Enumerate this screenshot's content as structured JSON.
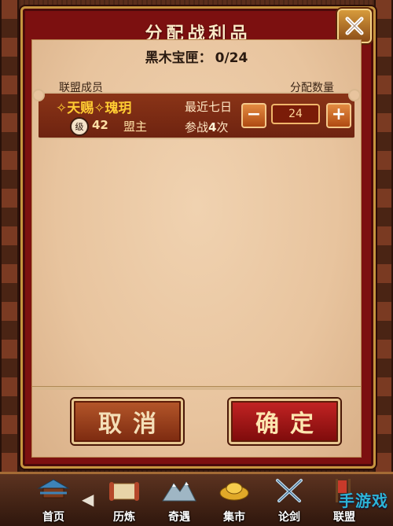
{
  "dialog": {
    "title": "分配战利品",
    "chest_label": "黑木宝匣：",
    "chest_count": "0/24"
  },
  "columns": {
    "member": "联盟成员",
    "quantity": "分配数量"
  },
  "member": {
    "name": "✧天赐✧瑰玥",
    "level_badge": "级",
    "level": "42",
    "role": "盟主",
    "recent_label": "最近七日",
    "battle_prefix": "参战",
    "battle_count": "4",
    "battle_suffix": "次",
    "quantity": "24"
  },
  "buttons": {
    "cancel": "取消",
    "confirm": "确定",
    "minus": "−",
    "plus": "+"
  },
  "nav": {
    "items": [
      {
        "label": "首页",
        "icon": "pagoda-icon"
      },
      {
        "label": "历炼",
        "icon": "scroll-icon"
      },
      {
        "label": "奇遇",
        "icon": "mountain-icon"
      },
      {
        "label": "集市",
        "icon": "gold-ingot-icon"
      },
      {
        "label": "论剑",
        "icon": "crossed-swords-icon"
      },
      {
        "label": "联盟",
        "icon": "banner-icon"
      }
    ]
  },
  "watermark": "手游戏"
}
